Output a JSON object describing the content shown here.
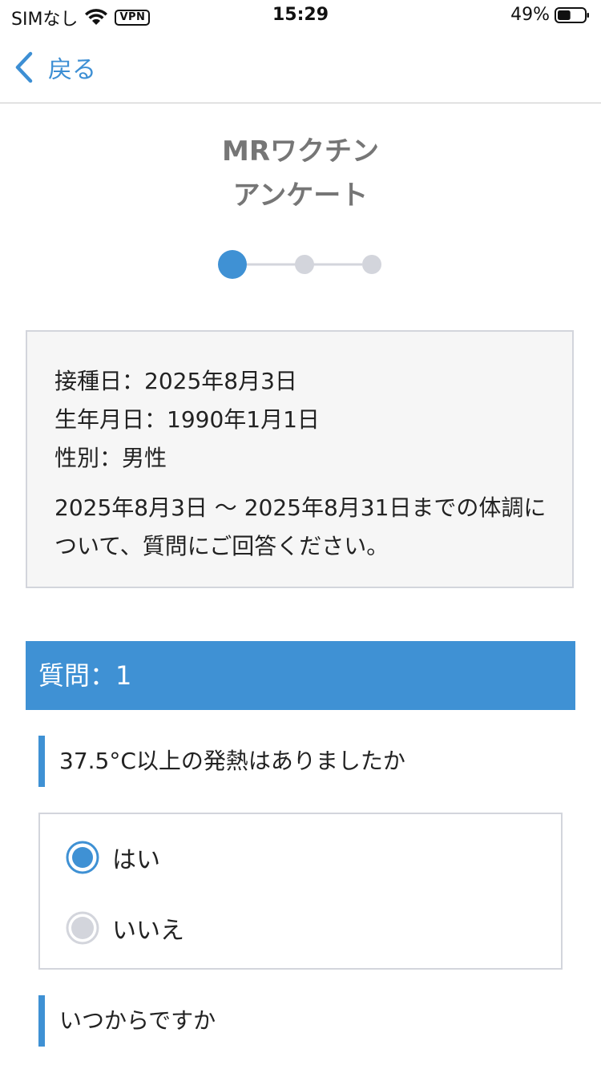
{
  "status_bar": {
    "carrier": "SIMなし",
    "vpn": "VPN",
    "time": "15:29",
    "battery": "49%",
    "battery_level": 0.49
  },
  "nav": {
    "back_label": "戻る"
  },
  "page": {
    "title_line1": "MRワクチン",
    "title_line2": "アンケート"
  },
  "stepper": {
    "total_steps": 3,
    "current_step": 1
  },
  "info": {
    "vaccination_date": "接種日：2025年8月3日",
    "birth_date": "生年月日：1990年1月1日",
    "gender": "性別：男性",
    "note": "2025年8月3日 〜 2025年8月31日までの体調について、質問にご回答ください。"
  },
  "question": {
    "header": "質問：1",
    "prompt": "37.5°C以上の発熱はありましたか",
    "options": [
      {
        "label": "はい",
        "selected": true
      },
      {
        "label": "いいえ",
        "selected": false
      }
    ],
    "followup": "いつからですか"
  },
  "colors": {
    "accent": "#3f91d4",
    "inactive": "#d3d5dc",
    "title_gray": "#767676"
  }
}
